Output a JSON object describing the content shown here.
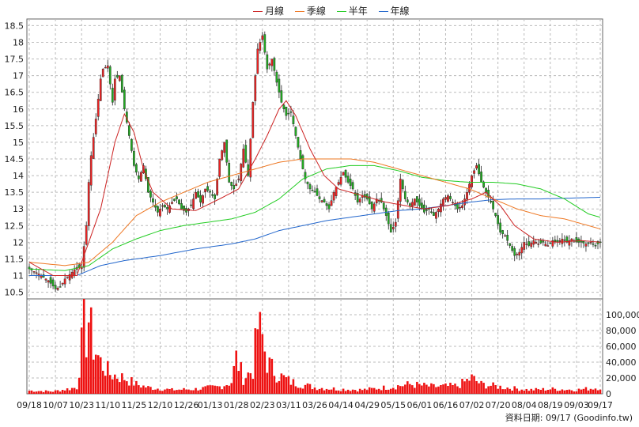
{
  "legend": [
    {
      "label": "月線",
      "color": "#cc2222"
    },
    {
      "label": "季線",
      "color": "#ee7722"
    },
    {
      "label": "半年",
      "color": "#22cc22"
    },
    {
      "label": "年線",
      "color": "#2266cc"
    }
  ],
  "source_text": "資料日期: 09/17  (Goodinfo.tw)",
  "chart_data": {
    "type": "candlestick",
    "price_axis": {
      "min": 10.3,
      "max": 18.7,
      "ticks": [
        10.5,
        11,
        11.5,
        12,
        12.5,
        13,
        13.5,
        14,
        14.5,
        15,
        15.5,
        16,
        16.5,
        17,
        17.5,
        18,
        18.5
      ]
    },
    "volume_axis": {
      "min": 0,
      "max": 120000,
      "ticks": [
        0,
        20000,
        40000,
        60000,
        80000,
        100000
      ],
      "tick_labels": [
        "0",
        "20,000",
        "40,000",
        "60,000",
        "80,000",
        "100,000"
      ]
    },
    "x_ticks": [
      {
        "i": 0,
        "label": "09/18"
      },
      {
        "i": 11,
        "label": "10/07"
      },
      {
        "i": 22,
        "label": "10/23"
      },
      {
        "i": 33,
        "label": "11/10"
      },
      {
        "i": 44,
        "label": "11/25"
      },
      {
        "i": 55,
        "label": "12/10"
      },
      {
        "i": 66,
        "label": "12/26"
      },
      {
        "i": 76,
        "label": "01/13"
      },
      {
        "i": 87,
        "label": "01/28"
      },
      {
        "i": 98,
        "label": "02/23"
      },
      {
        "i": 109,
        "label": "03/11"
      },
      {
        "i": 120,
        "label": "03/26"
      },
      {
        "i": 131,
        "label": "04/14"
      },
      {
        "i": 142,
        "label": "04/29"
      },
      {
        "i": 153,
        "label": "05/15"
      },
      {
        "i": 164,
        "label": "06/01"
      },
      {
        "i": 175,
        "label": "06/16"
      },
      {
        "i": 186,
        "label": "07/02"
      },
      {
        "i": 197,
        "label": "07/20"
      },
      {
        "i": 208,
        "label": "08/04"
      },
      {
        "i": 219,
        "label": "08/19"
      },
      {
        "i": 230,
        "label": "09/03"
      },
      {
        "i": 240,
        "label": "09/17"
      }
    ],
    "num_days": 241,
    "close_keypoints": [
      [
        0,
        11.2
      ],
      [
        4,
        11.05
      ],
      [
        8,
        10.85
      ],
      [
        11,
        10.6
      ],
      [
        13,
        10.65
      ],
      [
        15,
        10.9
      ],
      [
        18,
        11.1
      ],
      [
        20,
        11.25
      ],
      [
        22,
        11.25
      ],
      [
        24,
        12.5
      ],
      [
        25,
        13.8
      ],
      [
        26,
        14.6
      ],
      [
        28,
        15.7
      ],
      [
        30,
        16.9
      ],
      [
        31,
        17.2
      ],
      [
        33,
        17.3
      ],
      [
        35,
        16.2
      ],
      [
        36,
        16.9
      ],
      [
        38,
        17.0
      ],
      [
        40,
        16.0
      ],
      [
        42,
        15.2
      ],
      [
        44,
        14.3
      ],
      [
        46,
        13.9
      ],
      [
        48,
        14.3
      ],
      [
        50,
        13.5
      ],
      [
        52,
        13.2
      ],
      [
        54,
        12.9
      ],
      [
        56,
        13.1
      ],
      [
        58,
        13.0
      ],
      [
        60,
        13.2
      ],
      [
        62,
        13.3
      ],
      [
        64,
        13.0
      ],
      [
        66,
        12.9
      ],
      [
        68,
        13.1
      ],
      [
        70,
        13.5
      ],
      [
        72,
        13.2
      ],
      [
        74,
        13.6
      ],
      [
        76,
        13.5
      ],
      [
        78,
        13.3
      ],
      [
        80,
        14.5
      ],
      [
        82,
        15.0
      ],
      [
        84,
        13.8
      ],
      [
        86,
        13.6
      ],
      [
        88,
        13.9
      ],
      [
        90,
        14.8
      ],
      [
        92,
        14.0
      ],
      [
        94,
        16.2
      ],
      [
        96,
        17.8
      ],
      [
        98,
        18.2
      ],
      [
        100,
        17.2
      ],
      [
        102,
        17.5
      ],
      [
        104,
        16.8
      ],
      [
        106,
        16.2
      ],
      [
        108,
        15.8
      ],
      [
        110,
        15.9
      ],
      [
        112,
        15.2
      ],
      [
        114,
        14.5
      ],
      [
        116,
        13.9
      ],
      [
        118,
        13.6
      ],
      [
        120,
        13.5
      ],
      [
        122,
        13.3
      ],
      [
        124,
        13.2
      ],
      [
        126,
        13.0
      ],
      [
        128,
        13.5
      ],
      [
        130,
        13.8
      ],
      [
        132,
        14.1
      ],
      [
        134,
        13.8
      ],
      [
        136,
        13.6
      ],
      [
        138,
        13.2
      ],
      [
        140,
        13.4
      ],
      [
        142,
        13.3
      ],
      [
        144,
        13.0
      ],
      [
        146,
        13.3
      ],
      [
        148,
        13.2
      ],
      [
        150,
        12.8
      ],
      [
        152,
        12.3
      ],
      [
        154,
        12.6
      ],
      [
        156,
        13.9
      ],
      [
        158,
        13.3
      ],
      [
        160,
        13.1
      ],
      [
        162,
        13.3
      ],
      [
        164,
        13.1
      ],
      [
        166,
        12.9
      ],
      [
        168,
        13.0
      ],
      [
        170,
        12.8
      ],
      [
        172,
        13.0
      ],
      [
        174,
        13.3
      ],
      [
        176,
        13.4
      ],
      [
        178,
        13.2
      ],
      [
        180,
        13.0
      ],
      [
        182,
        13.1
      ],
      [
        184,
        13.5
      ],
      [
        186,
        14.0
      ],
      [
        188,
        14.3
      ],
      [
        190,
        13.8
      ],
      [
        192,
        13.5
      ],
      [
        194,
        13.2
      ],
      [
        196,
        12.8
      ],
      [
        198,
        12.3
      ],
      [
        200,
        12.2
      ],
      [
        202,
        11.9
      ],
      [
        204,
        11.6
      ],
      [
        206,
        11.7
      ],
      [
        208,
        12.0
      ],
      [
        210,
        11.9
      ],
      [
        212,
        12.05
      ],
      [
        214,
        11.95
      ],
      [
        216,
        12.0
      ],
      [
        218,
        11.9
      ],
      [
        220,
        12.05
      ],
      [
        222,
        12.0
      ],
      [
        224,
        12.1
      ],
      [
        226,
        12.0
      ],
      [
        228,
        12.1
      ],
      [
        230,
        12.0
      ],
      [
        232,
        12.0
      ],
      [
        234,
        11.95
      ],
      [
        236,
        12.0
      ],
      [
        238,
        11.9
      ],
      [
        240,
        12.0
      ]
    ],
    "volume_keypoints": [
      [
        0,
        4000
      ],
      [
        10,
        3000
      ],
      [
        20,
        8000
      ],
      [
        22,
        60000
      ],
      [
        23,
        115000
      ],
      [
        24,
        70000
      ],
      [
        25,
        95000
      ],
      [
        27,
        60000
      ],
      [
        30,
        40000
      ],
      [
        34,
        25000
      ],
      [
        40,
        20000
      ],
      [
        45,
        12000
      ],
      [
        50,
        8000
      ],
      [
        60,
        5000
      ],
      [
        70,
        6000
      ],
      [
        80,
        9000
      ],
      [
        85,
        15000
      ],
      [
        87,
        45000
      ],
      [
        90,
        20000
      ],
      [
        94,
        30000
      ],
      [
        96,
        85000
      ],
      [
        98,
        70000
      ],
      [
        100,
        40000
      ],
      [
        104,
        25000
      ],
      [
        110,
        15000
      ],
      [
        120,
        8000
      ],
      [
        130,
        6000
      ],
      [
        140,
        5000
      ],
      [
        150,
        8000
      ],
      [
        160,
        12000
      ],
      [
        170,
        9000
      ],
      [
        180,
        10000
      ],
      [
        186,
        20000
      ],
      [
        190,
        12000
      ],
      [
        200,
        8000
      ],
      [
        210,
        5000
      ],
      [
        220,
        6000
      ],
      [
        230,
        5000
      ],
      [
        240,
        8000
      ]
    ],
    "ma_month_keypoints": [
      [
        0,
        11.4
      ],
      [
        10,
        11.0
      ],
      [
        20,
        11.0
      ],
      [
        30,
        13.0
      ],
      [
        36,
        15.0
      ],
      [
        40,
        15.85
      ],
      [
        44,
        15.3
      ],
      [
        48,
        14.2
      ],
      [
        52,
        13.5
      ],
      [
        60,
        13.0
      ],
      [
        70,
        12.95
      ],
      [
        80,
        13.3
      ],
      [
        88,
        13.6
      ],
      [
        95,
        14.5
      ],
      [
        100,
        15.2
      ],
      [
        105,
        16.0
      ],
      [
        108,
        16.25
      ],
      [
        112,
        15.8
      ],
      [
        118,
        14.8
      ],
      [
        124,
        14.0
      ],
      [
        130,
        13.6
      ],
      [
        140,
        13.4
      ],
      [
        150,
        13.2
      ],
      [
        158,
        13.1
      ],
      [
        166,
        13.0
      ],
      [
        176,
        13.1
      ],
      [
        186,
        13.3
      ],
      [
        192,
        13.5
      ],
      [
        198,
        13.1
      ],
      [
        204,
        12.5
      ],
      [
        212,
        12.1
      ],
      [
        222,
        12.0
      ],
      [
        232,
        12.05
      ],
      [
        240,
        12.0
      ]
    ],
    "ma_quarter_keypoints": [
      [
        0,
        11.4
      ],
      [
        15,
        11.3
      ],
      [
        25,
        11.4
      ],
      [
        35,
        12.0
      ],
      [
        45,
        12.8
      ],
      [
        55,
        13.2
      ],
      [
        65,
        13.5
      ],
      [
        75,
        13.8
      ],
      [
        85,
        14.0
      ],
      [
        95,
        14.2
      ],
      [
        105,
        14.4
      ],
      [
        115,
        14.5
      ],
      [
        125,
        14.5
      ],
      [
        135,
        14.5
      ],
      [
        145,
        14.4
      ],
      [
        155,
        14.2
      ],
      [
        165,
        14.0
      ],
      [
        175,
        13.8
      ],
      [
        185,
        13.6
      ],
      [
        195,
        13.3
      ],
      [
        205,
        13.0
      ],
      [
        215,
        12.8
      ],
      [
        225,
        12.7
      ],
      [
        235,
        12.5
      ],
      [
        240,
        12.4
      ]
    ],
    "ma_half_keypoints": [
      [
        0,
        11.2
      ],
      [
        15,
        11.15
      ],
      [
        25,
        11.3
      ],
      [
        35,
        11.8
      ],
      [
        45,
        12.1
      ],
      [
        55,
        12.35
      ],
      [
        65,
        12.5
      ],
      [
        75,
        12.6
      ],
      [
        85,
        12.7
      ],
      [
        95,
        12.9
      ],
      [
        105,
        13.3
      ],
      [
        115,
        13.9
      ],
      [
        125,
        14.2
      ],
      [
        135,
        14.3
      ],
      [
        145,
        14.3
      ],
      [
        155,
        14.15
      ],
      [
        165,
        13.95
      ],
      [
        175,
        13.85
      ],
      [
        185,
        13.8
      ],
      [
        195,
        13.8
      ],
      [
        205,
        13.75
      ],
      [
        215,
        13.6
      ],
      [
        225,
        13.3
      ],
      [
        235,
        12.85
      ],
      [
        240,
        12.75
      ]
    ],
    "ma_year_keypoints": [
      [
        0,
        11.0
      ],
      [
        10,
        11.0
      ],
      [
        20,
        11.0
      ],
      [
        30,
        11.3
      ],
      [
        40,
        11.45
      ],
      [
        55,
        11.6
      ],
      [
        70,
        11.8
      ],
      [
        85,
        11.95
      ],
      [
        95,
        12.1
      ],
      [
        105,
        12.35
      ],
      [
        115,
        12.5
      ],
      [
        125,
        12.65
      ],
      [
        135,
        12.75
      ],
      [
        145,
        12.85
      ],
      [
        155,
        12.95
      ],
      [
        165,
        13.0
      ],
      [
        175,
        13.1
      ],
      [
        185,
        13.2
      ],
      [
        195,
        13.28
      ],
      [
        205,
        13.3
      ],
      [
        215,
        13.3
      ],
      [
        225,
        13.32
      ],
      [
        240,
        13.35
      ]
    ]
  }
}
